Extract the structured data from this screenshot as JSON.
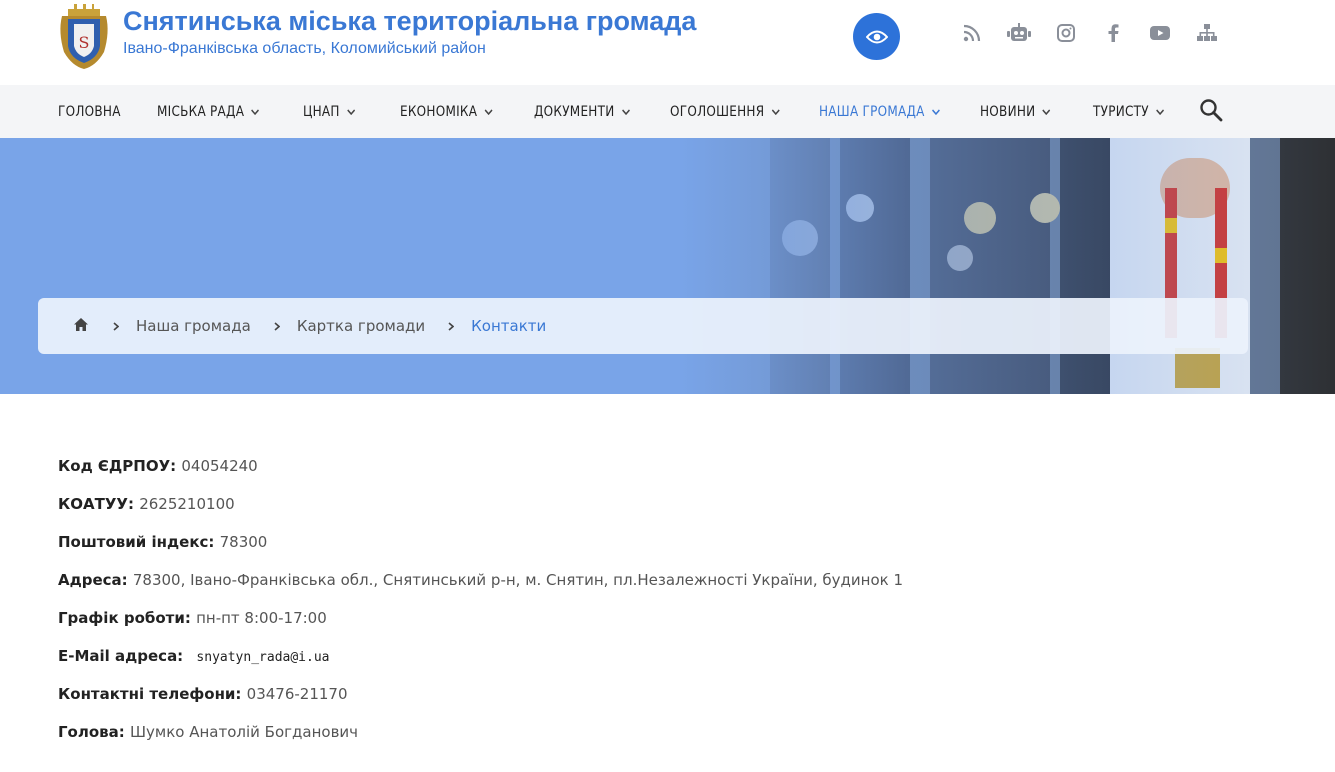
{
  "header": {
    "title": "Снятинська міська територіальна громада",
    "subtitle": "Івано-Франківська область, Коломийський район",
    "accessibility_icon": "eye-icon",
    "social_icons": [
      "rss-icon",
      "robot-icon",
      "instagram-icon",
      "facebook-icon",
      "youtube-icon",
      "sitemap-icon"
    ]
  },
  "nav": {
    "items": [
      {
        "label": "ГОЛОВНА"
      },
      {
        "label": "МІСЬКА РАДА"
      },
      {
        "label": "ЦНАП"
      },
      {
        "label": "ЕКОНОМІКА"
      },
      {
        "label": "ДОКУМЕНТИ"
      },
      {
        "label": "ОГОЛОШЕННЯ"
      },
      {
        "label": "НАША ГРОМАДА"
      },
      {
        "label": "НОВИНИ"
      },
      {
        "label": "ТУРИСТУ"
      }
    ]
  },
  "breadcrumb": {
    "items": [
      "Наша громада",
      "Картка громади",
      "Контакти"
    ]
  },
  "contacts": [
    {
      "label": "Код ЄДРПОУ:",
      "value": "04054240"
    },
    {
      "label": "КОАТУУ:",
      "value": "2625210100"
    },
    {
      "label": "Поштовий індекс:",
      "value": "78300"
    },
    {
      "label": "Адреса:",
      "value": "78300, Івано-Франківська обл., Снятинський р-н, м. Снятин, пл.Незалежності України, будинок 1"
    },
    {
      "label": "Графік роботи:",
      "value": "пн-пт 8:00-17:00"
    },
    {
      "label": "E-Mail адреса:",
      "value": "snyatyn_rada@i.ua"
    },
    {
      "label": "Контактні телефони:",
      "value": "03476-21170"
    },
    {
      "label": "Голова:",
      "value": "Шумко Анатолій Богданович"
    }
  ],
  "colors": {
    "brand": "#3a78d4",
    "hero_bg": "#79a4e8",
    "nav_bg": "#f4f5f7"
  }
}
